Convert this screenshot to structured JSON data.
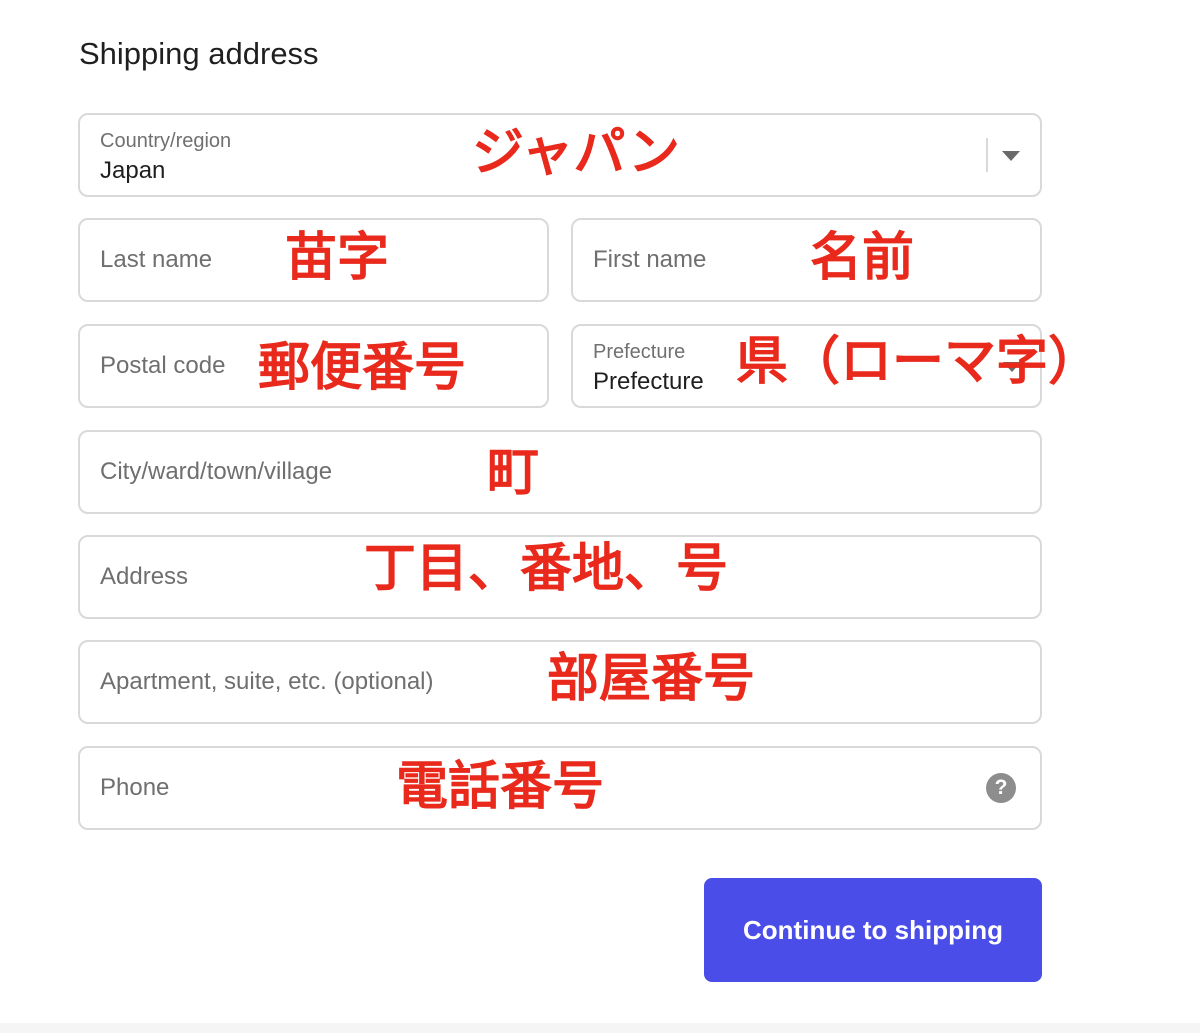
{
  "form": {
    "title": "Shipping address",
    "country": {
      "label": "Country/region",
      "value": "Japan",
      "annotation": "ジャパン"
    },
    "last_name": {
      "placeholder": "Last name",
      "annotation": "苗字"
    },
    "first_name": {
      "placeholder": "First name",
      "annotation": "名前"
    },
    "postal_code": {
      "placeholder": "Postal code",
      "annotation": "郵便番号"
    },
    "prefecture": {
      "label": "Prefecture",
      "value": "Prefecture",
      "annotation": "県（ローマ字）"
    },
    "city": {
      "placeholder": "City/ward/town/village",
      "annotation": "町"
    },
    "address": {
      "placeholder": "Address",
      "annotation": "丁目、番地、号"
    },
    "apartment": {
      "placeholder": "Apartment, suite, etc. (optional)",
      "annotation": "部屋番号"
    },
    "phone": {
      "placeholder": "Phone",
      "annotation": "電話番号",
      "help_icon": "question-circle-icon",
      "help_glyph": "?"
    },
    "submit_label": "Continue to shipping"
  },
  "colors": {
    "accent": "#4a4de7",
    "annotation": "#e8291c",
    "border": "#d9d9d9"
  }
}
